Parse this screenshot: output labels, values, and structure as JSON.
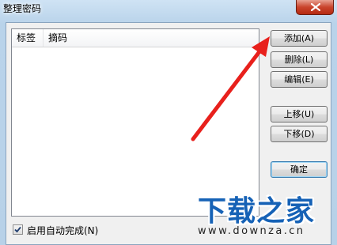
{
  "window": {
    "title": "整理密码"
  },
  "list": {
    "columns": [
      "标签",
      "摘码"
    ]
  },
  "buttons": {
    "add": "添加(A)",
    "delete": "删除(L)",
    "edit": "编辑(E)",
    "move_up": "上移(U)",
    "move_down": "下移(D)",
    "ok": "确定"
  },
  "autocomplete": {
    "label": "启用自动完成(N)",
    "checked": true
  },
  "watermark": {
    "logo": "下载之家",
    "url": "www.downza.cn"
  },
  "colors": {
    "annotation_arrow": "#e8201c",
    "watermark_blue": "#1662b6"
  }
}
